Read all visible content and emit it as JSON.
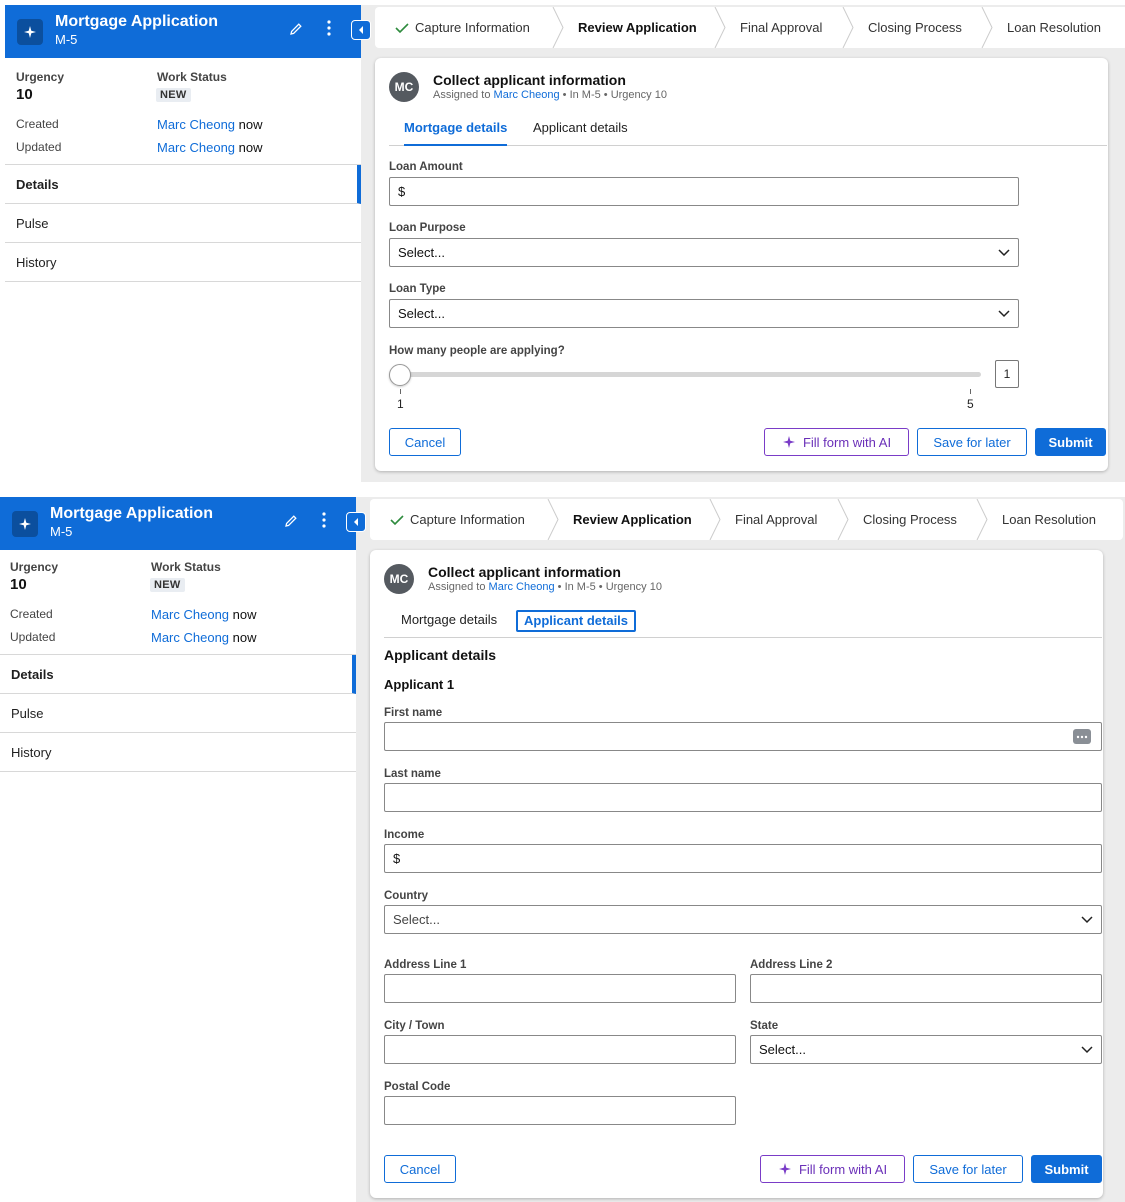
{
  "case": {
    "title": "Mortgage Application",
    "id": "M-5",
    "urgency_label": "Urgency",
    "urgency_value": "10",
    "work_status_label": "Work Status",
    "work_status_value": "NEW",
    "created_label": "Created",
    "updated_label": "Updated",
    "created_by": "Marc Cheong",
    "updated_by": "Marc Cheong",
    "created_when": "now",
    "updated_when": "now"
  },
  "nav": {
    "items": [
      {
        "label": "Details"
      },
      {
        "label": "Pulse"
      },
      {
        "label": "History"
      }
    ]
  },
  "stages": [
    {
      "label": "Capture Information",
      "status": "done"
    },
    {
      "label": "Review Application",
      "status": "current"
    },
    {
      "label": "Final Approval",
      "status": "pending"
    },
    {
      "label": "Closing Process",
      "status": "pending"
    },
    {
      "label": "Loan Resolution",
      "status": "pending"
    }
  ],
  "task": {
    "avatar_initials": "MC",
    "title": "Collect applicant information",
    "assigned_prefix": "Assigned to",
    "assignee": "Marc Cheong",
    "meta_suffix": "• In M-5 • Urgency 10"
  },
  "tabs": [
    {
      "label": "Mortgage details"
    },
    {
      "label": "Applicant details"
    }
  ],
  "mortgage_form": {
    "loan_amount_label": "Loan Amount",
    "loan_amount_prefix": "$",
    "loan_purpose_label": "Loan Purpose",
    "loan_purpose_value": "Select...",
    "loan_type_label": "Loan Type",
    "loan_type_value": "Select...",
    "applicants_label": "How many people are applying?",
    "applicants_value": "1",
    "applicants_min": "1",
    "applicants_max": "5"
  },
  "applicant_form": {
    "section_title": "Applicant details",
    "applicant_heading": "Applicant 1",
    "first_name_label": "First name",
    "last_name_label": "Last name",
    "income_label": "Income",
    "income_prefix": "$",
    "country_label": "Country",
    "country_value": "Select...",
    "address1_label": "Address Line 1",
    "address2_label": "Address Line 2",
    "city_label": "City / Town",
    "state_label": "State",
    "state_value": "Select...",
    "postal_label": "Postal Code"
  },
  "actions": {
    "cancel": "Cancel",
    "fill_ai": "Fill form with AI",
    "save_later": "Save for later",
    "submit": "Submit"
  },
  "colors": {
    "brand": "#0f6cd8",
    "ai_accent": "#7a3cc7",
    "success_check": "#2e8b3d"
  }
}
